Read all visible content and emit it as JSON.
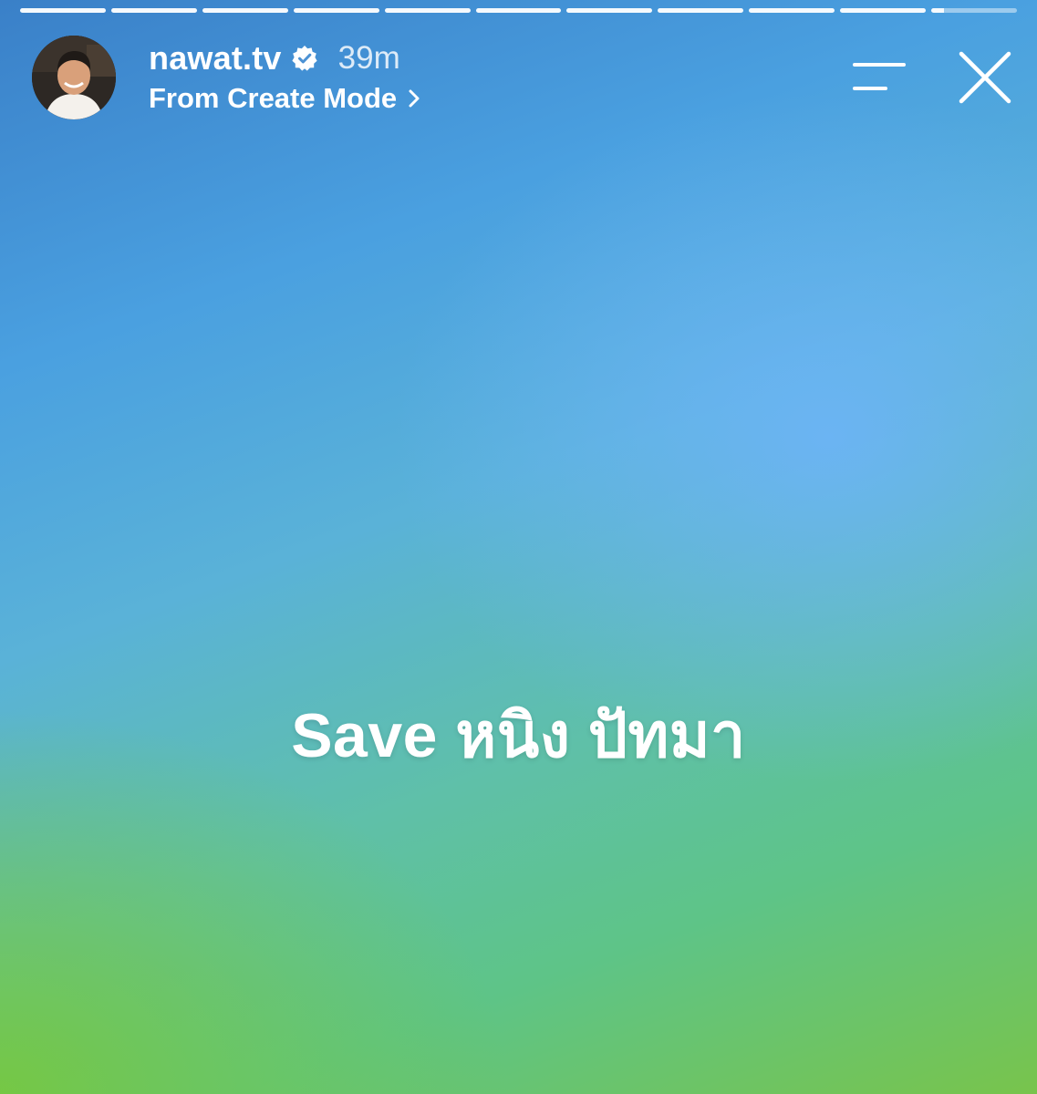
{
  "story": {
    "progress_segments": [
      {
        "state": "complete"
      },
      {
        "state": "complete"
      },
      {
        "state": "complete"
      },
      {
        "state": "complete"
      },
      {
        "state": "complete"
      },
      {
        "state": "complete"
      },
      {
        "state": "complete"
      },
      {
        "state": "complete"
      },
      {
        "state": "complete"
      },
      {
        "state": "complete"
      },
      {
        "state": "current",
        "fill": 0.15
      }
    ],
    "header": {
      "username": "nawat.tv",
      "verified": true,
      "verified_icon": "verified-badge-icon",
      "time": "39m",
      "subtitle": "From Create Mode",
      "subtitle_icon": "chevron-right-icon",
      "menu_icon": "menu-icon",
      "close_icon": "close-icon"
    },
    "caption": "Save หนิง ปัทมา",
    "colors": {
      "text": "#ffffff",
      "gradient_top": "#3a80c8",
      "gradient_right": "#6bb8f5",
      "gradient_bottom_left": "#78c44c"
    }
  }
}
